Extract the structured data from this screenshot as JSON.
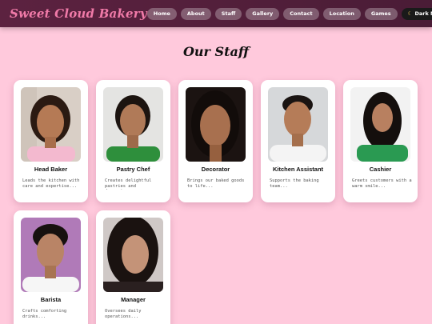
{
  "header": {
    "brand": "Sweet Cloud Bakery",
    "nav": [
      "Home",
      "About",
      "Staff",
      "Gallery",
      "Contact",
      "Location",
      "Games"
    ],
    "dark_mode_label": "Dark Mode",
    "dark_mode_icon": "moon-icon"
  },
  "page": {
    "title": "Our Staff"
  },
  "staff": [
    {
      "role": "Head Baker",
      "description": "Leads the kitchen with care and expertise..."
    },
    {
      "role": "Pastry Chef",
      "description": "Creates delightful pastries and desserts..."
    },
    {
      "role": "Decorator",
      "description": "Brings our baked goods to life..."
    },
    {
      "role": "Kitchen Assistant",
      "description": "Supports the baking team..."
    },
    {
      "role": "Cashier",
      "description": "Greets customers with a warm smile..."
    },
    {
      "role": "Barista",
      "description": "Crafts comforting drinks..."
    },
    {
      "role": "Manager",
      "description": "Oversees daily operations..."
    }
  ],
  "colors": {
    "background": "#ffc9dc",
    "navbar": "#5c2240",
    "brand": "#f07aa8"
  }
}
